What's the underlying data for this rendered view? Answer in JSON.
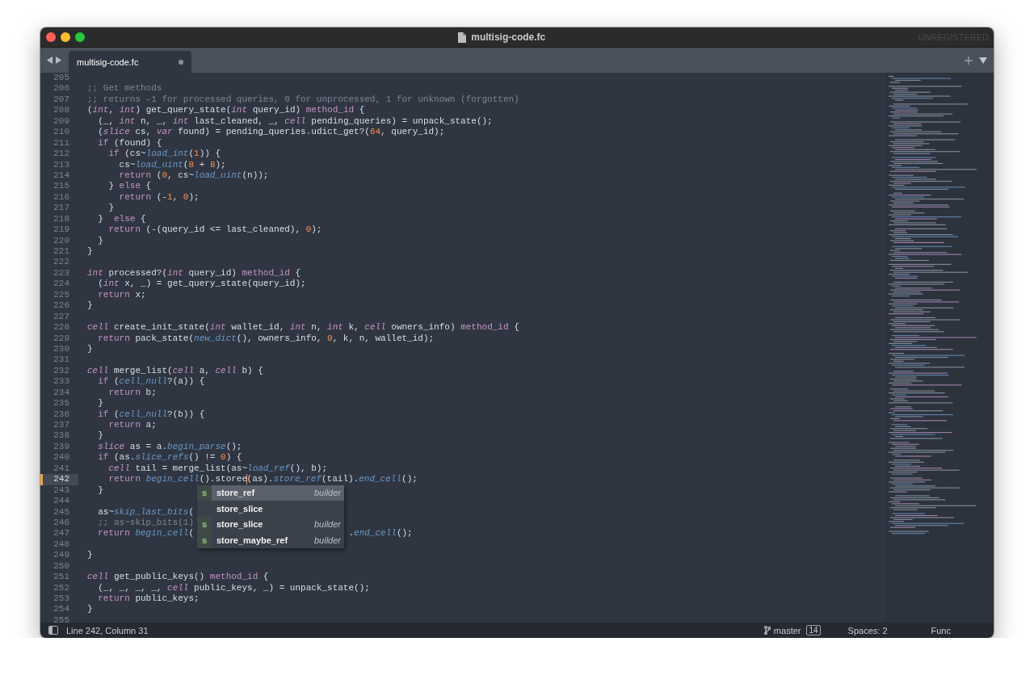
{
  "window": {
    "title": "multisig-code.fc",
    "license": "UNREGISTERED"
  },
  "tabs": [
    {
      "label": "multisig-code.fc",
      "selected": true,
      "modified": true
    }
  ],
  "editor": {
    "lines": [
      {
        "number": "205",
        "current": false
      },
      {
        "number": "206",
        "current": false,
        "tokens": [
          {
            "kind": "comment",
            "text": ";; Get methods"
          }
        ]
      },
      {
        "number": "207",
        "current": false,
        "tokens": [
          {
            "kind": "comment",
            "text": ";; returns -1 for processed queries, 0 for unprocessed, 1 for unknown (forgotten)"
          }
        ]
      },
      {
        "number": "208",
        "current": false,
        "tokens": [
          {
            "kind": "plain",
            "text": "("
          },
          {
            "kind": "type",
            "text": "int"
          },
          {
            "kind": "plain",
            "text": ", "
          },
          {
            "kind": "type",
            "text": "int"
          },
          {
            "kind": "plain",
            "text": ") get_query_state("
          },
          {
            "kind": "type",
            "text": "int"
          },
          {
            "kind": "plain",
            "text": " query_id) "
          },
          {
            "kind": "keyword",
            "text": "method_id"
          },
          {
            "kind": "plain",
            "text": " {"
          }
        ]
      },
      {
        "number": "209",
        "current": false,
        "tokens": [
          {
            "kind": "plain",
            "text": "  (_, "
          },
          {
            "kind": "type",
            "text": "int"
          },
          {
            "kind": "plain",
            "text": " n, _, "
          },
          {
            "kind": "type",
            "text": "int"
          },
          {
            "kind": "plain",
            "text": " last_cleaned, _, "
          },
          {
            "kind": "type",
            "text": "cell"
          },
          {
            "kind": "plain",
            "text": " pending_queries) = unpack_state();"
          }
        ]
      },
      {
        "number": "210",
        "current": false,
        "tokens": [
          {
            "kind": "plain",
            "text": "  ("
          },
          {
            "kind": "type",
            "text": "slice"
          },
          {
            "kind": "plain",
            "text": " cs, "
          },
          {
            "kind": "type",
            "text": "var"
          },
          {
            "kind": "plain",
            "text": " found) = pending_queries.udict_get?("
          },
          {
            "kind": "number",
            "text": "64"
          },
          {
            "kind": "plain",
            "text": ", query_id);"
          }
        ]
      },
      {
        "number": "211",
        "current": false,
        "tokens": [
          {
            "kind": "keyword",
            "text": "  if"
          },
          {
            "kind": "plain",
            "text": " (found) {"
          }
        ]
      },
      {
        "number": "212",
        "current": false,
        "tokens": [
          {
            "kind": "keyword",
            "text": "    if"
          },
          {
            "kind": "plain",
            "text": " (cs~"
          },
          {
            "kind": "call",
            "text": "load_int"
          },
          {
            "kind": "plain",
            "text": "("
          },
          {
            "kind": "number",
            "text": "1"
          },
          {
            "kind": "plain",
            "text": ")) {"
          }
        ]
      },
      {
        "number": "213",
        "current": false,
        "tokens": [
          {
            "kind": "plain",
            "text": "      cs~"
          },
          {
            "kind": "call",
            "text": "load_uint"
          },
          {
            "kind": "plain",
            "text": "("
          },
          {
            "kind": "number",
            "text": "8"
          },
          {
            "kind": "plain",
            "text": " + "
          },
          {
            "kind": "number",
            "text": "8"
          },
          {
            "kind": "plain",
            "text": ");"
          }
        ]
      },
      {
        "number": "214",
        "current": false,
        "tokens": [
          {
            "kind": "keyword",
            "text": "      return"
          },
          {
            "kind": "plain",
            "text": " ("
          },
          {
            "kind": "number",
            "text": "0"
          },
          {
            "kind": "plain",
            "text": ", cs~"
          },
          {
            "kind": "call",
            "text": "load_uint"
          },
          {
            "kind": "plain",
            "text": "(n));"
          }
        ]
      },
      {
        "number": "215",
        "current": false,
        "tokens": [
          {
            "kind": "plain",
            "text": "    } "
          },
          {
            "kind": "keyword",
            "text": "else"
          },
          {
            "kind": "plain",
            "text": " {"
          }
        ]
      },
      {
        "number": "216",
        "current": false,
        "tokens": [
          {
            "kind": "keyword",
            "text": "      return"
          },
          {
            "kind": "plain",
            "text": " (-"
          },
          {
            "kind": "number",
            "text": "1"
          },
          {
            "kind": "plain",
            "text": ", "
          },
          {
            "kind": "number",
            "text": "0"
          },
          {
            "kind": "plain",
            "text": ");"
          }
        ]
      },
      {
        "number": "217",
        "current": false,
        "tokens": [
          {
            "kind": "plain",
            "text": "    }"
          }
        ]
      },
      {
        "number": "218",
        "current": false,
        "tokens": [
          {
            "kind": "plain",
            "text": "  }  "
          },
          {
            "kind": "keyword",
            "text": "else"
          },
          {
            "kind": "plain",
            "text": " {"
          }
        ]
      },
      {
        "number": "219",
        "current": false,
        "tokens": [
          {
            "kind": "keyword",
            "text": "    return"
          },
          {
            "kind": "plain",
            "text": " (-(query_id <= last_cleaned), "
          },
          {
            "kind": "number",
            "text": "0"
          },
          {
            "kind": "plain",
            "text": ");"
          }
        ]
      },
      {
        "number": "220",
        "current": false,
        "tokens": [
          {
            "kind": "plain",
            "text": "  }"
          }
        ]
      },
      {
        "number": "221",
        "current": false,
        "tokens": [
          {
            "kind": "plain",
            "text": "}"
          }
        ]
      },
      {
        "number": "222",
        "current": false
      },
      {
        "number": "223",
        "current": false,
        "tokens": [
          {
            "kind": "type",
            "text": "int"
          },
          {
            "kind": "plain",
            "text": " processed?("
          },
          {
            "kind": "type",
            "text": "int"
          },
          {
            "kind": "plain",
            "text": " query_id) "
          },
          {
            "kind": "keyword",
            "text": "method_id"
          },
          {
            "kind": "plain",
            "text": " {"
          }
        ]
      },
      {
        "number": "224",
        "current": false,
        "tokens": [
          {
            "kind": "plain",
            "text": "  ("
          },
          {
            "kind": "type",
            "text": "int"
          },
          {
            "kind": "plain",
            "text": " x, _) = get_query_state(query_id);"
          }
        ]
      },
      {
        "number": "225",
        "current": false,
        "tokens": [
          {
            "kind": "keyword",
            "text": "  return"
          },
          {
            "kind": "plain",
            "text": " x;"
          }
        ]
      },
      {
        "number": "226",
        "current": false,
        "tokens": [
          {
            "kind": "plain",
            "text": "}"
          }
        ]
      },
      {
        "number": "227",
        "current": false
      },
      {
        "number": "228",
        "current": false,
        "tokens": [
          {
            "kind": "type",
            "text": "cell"
          },
          {
            "kind": "plain",
            "text": " create_init_state("
          },
          {
            "kind": "type",
            "text": "int"
          },
          {
            "kind": "plain",
            "text": " wallet_id, "
          },
          {
            "kind": "type",
            "text": "int"
          },
          {
            "kind": "plain",
            "text": " n, "
          },
          {
            "kind": "type",
            "text": "int"
          },
          {
            "kind": "plain",
            "text": " k, "
          },
          {
            "kind": "type",
            "text": "cell"
          },
          {
            "kind": "plain",
            "text": " owners_info) "
          },
          {
            "kind": "keyword",
            "text": "method_id"
          },
          {
            "kind": "plain",
            "text": " {"
          }
        ]
      },
      {
        "number": "229",
        "current": false,
        "tokens": [
          {
            "kind": "keyword",
            "text": "  return"
          },
          {
            "kind": "plain",
            "text": " pack_state("
          },
          {
            "kind": "call",
            "text": "new_dict"
          },
          {
            "kind": "plain",
            "text": "(), owners_info, "
          },
          {
            "kind": "number",
            "text": "0"
          },
          {
            "kind": "plain",
            "text": ", k, n, wallet_id);"
          }
        ]
      },
      {
        "number": "230",
        "current": false,
        "tokens": [
          {
            "kind": "plain",
            "text": "}"
          }
        ]
      },
      {
        "number": "231",
        "current": false
      },
      {
        "number": "232",
        "current": false,
        "tokens": [
          {
            "kind": "type",
            "text": "cell"
          },
          {
            "kind": "plain",
            "text": " merge_list("
          },
          {
            "kind": "type",
            "text": "cell"
          },
          {
            "kind": "plain",
            "text": " a, "
          },
          {
            "kind": "type",
            "text": "cell"
          },
          {
            "kind": "plain",
            "text": " b) {"
          }
        ]
      },
      {
        "number": "233",
        "current": false,
        "tokens": [
          {
            "kind": "keyword",
            "text": "  if"
          },
          {
            "kind": "plain",
            "text": " ("
          },
          {
            "kind": "call",
            "text": "cell_null"
          },
          {
            "kind": "plain",
            "text": "?(a)) {"
          }
        ]
      },
      {
        "number": "234",
        "current": false,
        "tokens": [
          {
            "kind": "keyword",
            "text": "    return"
          },
          {
            "kind": "plain",
            "text": " b;"
          }
        ]
      },
      {
        "number": "235",
        "current": false,
        "tokens": [
          {
            "kind": "plain",
            "text": "  }"
          }
        ]
      },
      {
        "number": "236",
        "current": false,
        "tokens": [
          {
            "kind": "keyword",
            "text": "  if"
          },
          {
            "kind": "plain",
            "text": " ("
          },
          {
            "kind": "call",
            "text": "cell_null"
          },
          {
            "kind": "plain",
            "text": "?(b)) {"
          }
        ]
      },
      {
        "number": "237",
        "current": false,
        "tokens": [
          {
            "kind": "keyword",
            "text": "    return"
          },
          {
            "kind": "plain",
            "text": " a;"
          }
        ]
      },
      {
        "number": "238",
        "current": false,
        "tokens": [
          {
            "kind": "plain",
            "text": "  }"
          }
        ]
      },
      {
        "number": "239",
        "current": false,
        "tokens": [
          {
            "kind": "type",
            "text": "  slice"
          },
          {
            "kind": "plain",
            "text": " as = a."
          },
          {
            "kind": "call",
            "text": "begin_parse"
          },
          {
            "kind": "plain",
            "text": "();"
          }
        ]
      },
      {
        "number": "240",
        "current": false,
        "tokens": [
          {
            "kind": "keyword",
            "text": "  if"
          },
          {
            "kind": "plain",
            "text": " (as."
          },
          {
            "kind": "call",
            "text": "slice_refs"
          },
          {
            "kind": "plain",
            "text": "() != "
          },
          {
            "kind": "number",
            "text": "0"
          },
          {
            "kind": "plain",
            "text": ") {"
          }
        ]
      },
      {
        "number": "241",
        "current": false,
        "tokens": [
          {
            "kind": "type",
            "text": "    cell"
          },
          {
            "kind": "plain",
            "text": " tail = merge_list(as~"
          },
          {
            "kind": "call",
            "text": "load_ref"
          },
          {
            "kind": "plain",
            "text": "(), b);"
          }
        ]
      },
      {
        "number": "242",
        "current": true,
        "tokens": [
          {
            "kind": "keyword",
            "text": "    return "
          },
          {
            "kind": "call",
            "text": "begin_cell"
          },
          {
            "kind": "plain",
            "text": "().storee"
          },
          {
            "kind": "caret"
          },
          {
            "kind": "plain",
            "text": "(as)."
          },
          {
            "kind": "call",
            "text": "store_ref"
          },
          {
            "kind": "plain",
            "text": "(tail)."
          },
          {
            "kind": "call",
            "text": "end_cell"
          },
          {
            "kind": "plain",
            "text": "();"
          }
        ]
      },
      {
        "number": "243",
        "current": false,
        "tokens": [
          {
            "kind": "plain",
            "text": "  }"
          }
        ]
      },
      {
        "number": "244",
        "current": false
      },
      {
        "number": "245",
        "current": false,
        "tokens": [
          {
            "kind": "plain",
            "text": "  as~"
          },
          {
            "kind": "call",
            "text": "skip_last_bits"
          },
          {
            "kind": "plain",
            "text": "("
          }
        ]
      },
      {
        "number": "246",
        "current": false,
        "tokens": [
          {
            "kind": "comment",
            "text": "  ;; as~skip_bits(1)"
          }
        ]
      },
      {
        "number": "247",
        "current": false,
        "tokens": [
          {
            "kind": "keyword",
            "text": "  return "
          },
          {
            "kind": "call",
            "text": "begin_cell"
          },
          {
            "kind": "plain",
            "text": "(                             ."
          },
          {
            "kind": "call",
            "text": "end_cell"
          },
          {
            "kind": "plain",
            "text": "();"
          }
        ]
      },
      {
        "number": "248",
        "current": false
      },
      {
        "number": "249",
        "current": false,
        "tokens": [
          {
            "kind": "plain",
            "text": "}"
          }
        ]
      },
      {
        "number": "250",
        "current": false
      },
      {
        "number": "251",
        "current": false,
        "tokens": [
          {
            "kind": "type",
            "text": "cell"
          },
          {
            "kind": "plain",
            "text": " get_public_keys() "
          },
          {
            "kind": "keyword",
            "text": "method_id"
          },
          {
            "kind": "plain",
            "text": " {"
          }
        ]
      },
      {
        "number": "252",
        "current": false,
        "tokens": [
          {
            "kind": "plain",
            "text": "  (_, _, _, _, "
          },
          {
            "kind": "type",
            "text": "cell"
          },
          {
            "kind": "plain",
            "text": " public_keys, _) = unpack_state();"
          }
        ]
      },
      {
        "number": "253",
        "current": false,
        "tokens": [
          {
            "kind": "keyword",
            "text": "  return"
          },
          {
            "kind": "plain",
            "text": " public_keys;"
          }
        ]
      },
      {
        "number": "254",
        "current": false,
        "tokens": [
          {
            "kind": "plain",
            "text": "}"
          }
        ]
      },
      {
        "number": "255",
        "current": false
      }
    ]
  },
  "completion": {
    "items": [
      {
        "badge": "s",
        "label": "store_ref",
        "detail": "builder",
        "selected": true
      },
      {
        "label": "store_slice",
        "selected": false
      },
      {
        "badge": "s",
        "label": "store_slice",
        "detail": "builder",
        "selected": false
      },
      {
        "badge": "s",
        "label": "store_maybe_ref",
        "detail": "builder",
        "selected": false
      }
    ]
  },
  "status_bar": {
    "position": "Line 242, Column 31",
    "branch": "master",
    "branch_badge": "14",
    "indentation": "Spaces: 2",
    "syntax": "Func"
  }
}
